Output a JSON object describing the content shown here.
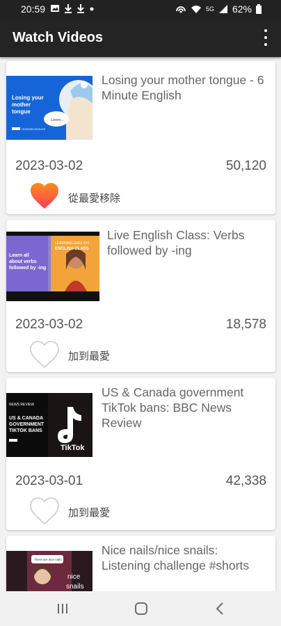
{
  "status_bar": {
    "time": "20:59",
    "battery": "62%",
    "network": "5G"
  },
  "app_bar": {
    "title": "Watch Videos"
  },
  "videos": [
    {
      "title": "Losing your mother tongue - 6 Minute English",
      "date": "2023-03-02",
      "views": "50,120",
      "favorited": true,
      "fav_label": "從最愛移除",
      "thumb_text": "Losing your mother tongue",
      "thumb_brand": "BBC LEARNING ENGLISH"
    },
    {
      "title": "Live English Class: Verbs followed by -ing",
      "date": "2023-03-02",
      "views": "18,578",
      "favorited": false,
      "fav_label": "加到最愛",
      "thumb_text": "Learn all about verbs followed by -ing",
      "thumb_brand": "ENGLISH CLASS"
    },
    {
      "title": "US & Canada government TikTok bans: BBC News Review",
      "date": "2023-03-01",
      "views": "42,338",
      "favorited": false,
      "fav_label": "加到最愛",
      "thumb_text": "US & CANADA GOVERNMENT TIKTOK BANS",
      "thumb_brand": "TikTok"
    },
    {
      "title": "Nice nails/nice snails: Listening challenge #shorts",
      "thumb_text": "nice snails"
    }
  ],
  "colors": {
    "app_bar": "#242424",
    "status_bar": "#222222",
    "heart_fill_top": "#ff8c1a",
    "heart_fill_bottom": "#ff3d5a",
    "heart_outline": "#cfcfcf"
  }
}
